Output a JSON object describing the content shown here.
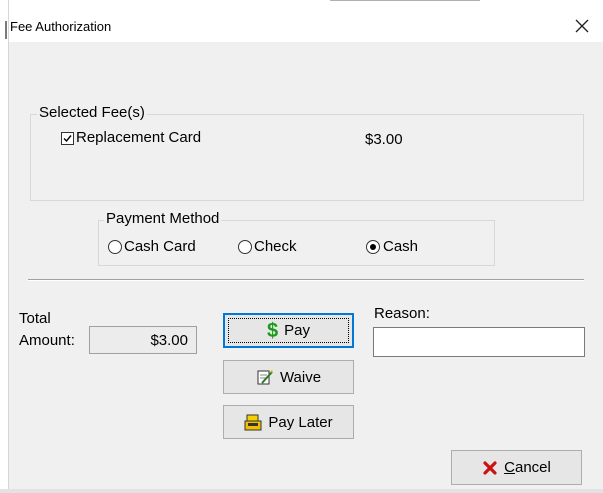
{
  "window": {
    "title": "Fee Authorization",
    "close_icon": "close-icon"
  },
  "selected_fees": {
    "legend": "Selected Fee(s)",
    "items": [
      {
        "label": "Replacement Card",
        "amount": "$3.00",
        "checked": true
      }
    ]
  },
  "payment_method": {
    "legend": "Payment Method",
    "options": [
      {
        "label": "Cash Card",
        "checked": false
      },
      {
        "label": "Check",
        "checked": false
      },
      {
        "label": "Cash",
        "checked": true
      }
    ]
  },
  "total": {
    "label_line1": "Total",
    "label_line2": "Amount:",
    "value": "$3.00"
  },
  "buttons": {
    "pay": {
      "label": "Pay",
      "icon": "dollar-icon",
      "icon_color": "#1a9a1a"
    },
    "waive": {
      "label": "Waive",
      "icon": "waive-icon"
    },
    "pay_later": {
      "label": "Pay Later",
      "icon": "register-icon"
    },
    "cancel": {
      "label": "Cancel",
      "mnemonic": "C",
      "icon": "x-icon",
      "icon_color": "#cc1111"
    }
  },
  "reason": {
    "label": "Reason:",
    "value": ""
  },
  "colors": {
    "focus_border": "#0078d7",
    "dialog_bg": "#f0f0f0"
  }
}
